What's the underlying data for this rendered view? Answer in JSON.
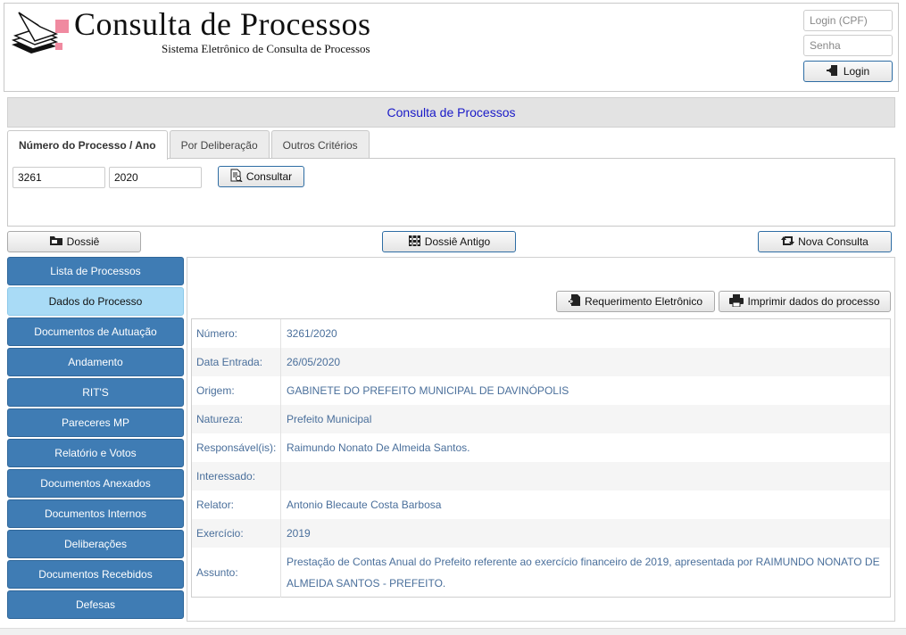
{
  "header": {
    "title": "Consulta  de  Processos",
    "subtitle": "Sistema Eletrônico de Consulta de Processos",
    "login_placeholder": "Login (CPF)",
    "password_placeholder": "Senha",
    "login_label": "Login"
  },
  "page_title": "Consulta de Processos",
  "tabs": [
    {
      "label": "Número do Processo / Ano",
      "active": true
    },
    {
      "label": "Por Deliberação",
      "active": false
    },
    {
      "label": "Outros Critérios",
      "active": false
    }
  ],
  "search": {
    "numero_value": "3261",
    "ano_value": "2020",
    "consultar_label": "Consultar"
  },
  "actions": {
    "dossie_label": "Dossiê",
    "dossie_antigo_label": "Dossiê Antigo",
    "nova_consulta_label": "Nova Consulta",
    "requerimento_label": "Requerimento Eletrônico",
    "imprimir_label": "Imprimir dados do processo"
  },
  "sidebar": {
    "items": [
      {
        "label": "Lista de Processos"
      },
      {
        "label": "Dados do Processo",
        "active": true
      },
      {
        "label": "Documentos de Autuação"
      },
      {
        "label": "Andamento"
      },
      {
        "label": "RIT'S"
      },
      {
        "label": "Pareceres MP"
      },
      {
        "label": "Relatório e Votos"
      },
      {
        "label": "Documentos Anexados"
      },
      {
        "label": "Documentos Internos"
      },
      {
        "label": "Deliberações"
      },
      {
        "label": "Documentos Recebidos"
      },
      {
        "label": "Defesas"
      }
    ]
  },
  "details": [
    {
      "label": "Número:",
      "value": "3261/2020"
    },
    {
      "label": "Data Entrada:",
      "value": "26/05/2020"
    },
    {
      "label": "Origem:",
      "value": "GABINETE DO PREFEITO MUNICIPAL DE DAVINÓPOLIS"
    },
    {
      "label": "Natureza:",
      "value": "Prefeito Municipal"
    },
    {
      "label": "Responsável(is):",
      "value": "Raimundo Nonato De Almeida Santos."
    },
    {
      "label": "Interessado:",
      "value": ""
    },
    {
      "label": "Relator:",
      "value": "Antonio Blecaute Costa Barbosa"
    },
    {
      "label": "Exercício:",
      "value": "2019"
    },
    {
      "label": "Assunto:",
      "value": "Prestação de Contas Anual do Prefeito referente ao exercício financeiro de 2019, apresentada por RAIMUNDO NONATO DE ALMEIDA SANTOS - PREFEITO."
    }
  ],
  "colors": {
    "accent": "#3f7cb4",
    "active_item": "#a9dbf6",
    "title_text": "#1a1ac8",
    "value_text": "#4a6f9b"
  }
}
